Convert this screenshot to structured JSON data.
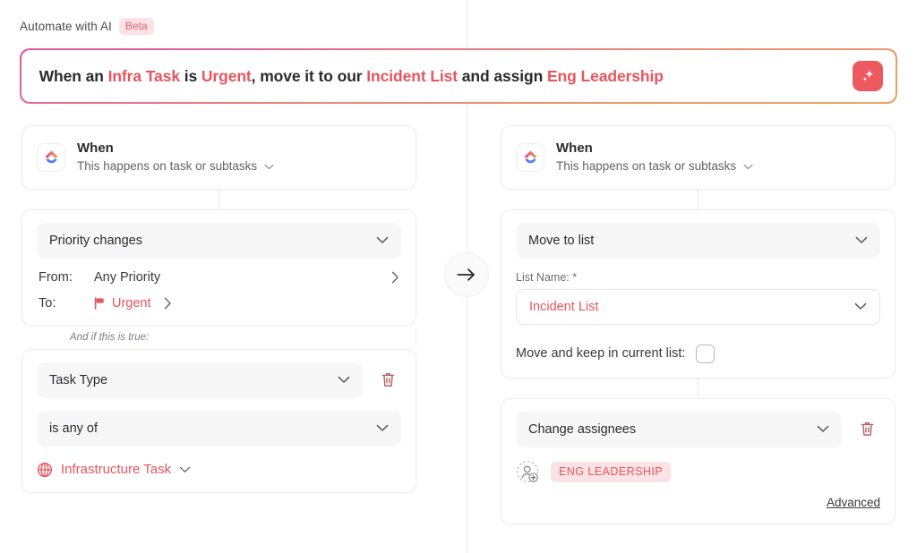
{
  "header": {
    "title": "Automate with AI",
    "badge": "Beta"
  },
  "prompt": {
    "segments": [
      {
        "text": "When an ",
        "highlight": false
      },
      {
        "text": "Infra Task",
        "highlight": true
      },
      {
        "text": " is ",
        "highlight": false
      },
      {
        "text": "Urgent",
        "highlight": true
      },
      {
        "text": ", move it to our ",
        "highlight": false
      },
      {
        "text": "Incident List",
        "highlight": true
      },
      {
        "text": " and assign ",
        "highlight": false
      },
      {
        "text": "Eng Leadership",
        "highlight": true
      }
    ],
    "generate_icon": "sparkle-icon"
  },
  "trigger": {
    "title": "When",
    "subtitle": "This happens on task or subtasks",
    "chevron": "chevron-down-icon",
    "logo_icon": "clickup-logo-icon"
  },
  "left_column": {
    "trigger_select": "Priority changes",
    "rows": [
      {
        "key": "From:",
        "value": "Any Priority",
        "flag": false
      },
      {
        "key": "To:",
        "value": "Urgent",
        "flag": true
      }
    ],
    "condition_label": "And if this is true:",
    "condition_field": "Task Type",
    "condition_operator": "is any of",
    "condition_value": "Infrastructure Task",
    "delete_icon": "trash-icon",
    "value_icon": "globe-icon"
  },
  "right_column": {
    "action_select": "Move to list",
    "list_name_label": "List Name: *",
    "list_name_value": "Incident List",
    "keep_in_list_label": "Move and keep in current list:",
    "keep_in_list_checked": false,
    "assignee_action": "Change assignees",
    "assignee_chip": "ENG LEADERSHIP",
    "advanced_label": "Advanced",
    "delete_icon": "trash-icon",
    "add_assignee_icon": "add-person-icon"
  },
  "center": {
    "arrow_icon": "arrow-right-icon"
  },
  "colors": {
    "accent_red": "#e8555e",
    "badge_bg": "#fbe3e5",
    "gradient_start": "#e0589f",
    "gradient_end": "#e8a55f"
  }
}
